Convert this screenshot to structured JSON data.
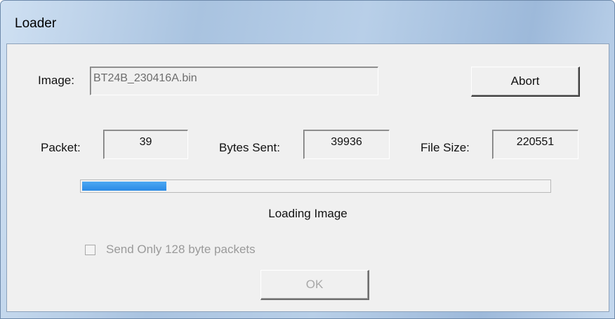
{
  "window": {
    "title": "Loader"
  },
  "image_row": {
    "label": "Image:",
    "value": "BT24B_230416A.bin"
  },
  "abort_button": {
    "label": "Abort"
  },
  "packet": {
    "label": "Packet:",
    "value": "39"
  },
  "bytes_sent": {
    "label": "Bytes Sent:",
    "value": "39936"
  },
  "file_size": {
    "label": "File Size:",
    "value": "220551"
  },
  "progress": {
    "fraction": 0.18
  },
  "status": {
    "text": "Loading Image"
  },
  "checkbox": {
    "label": "Send Only 128 byte packets",
    "checked": false,
    "enabled": false
  },
  "ok_button": {
    "label": "OK",
    "enabled": false
  },
  "colors": {
    "accent": "#2b8ae6",
    "title_bar": "#a9c3e0",
    "face": "#f0f0f0"
  }
}
